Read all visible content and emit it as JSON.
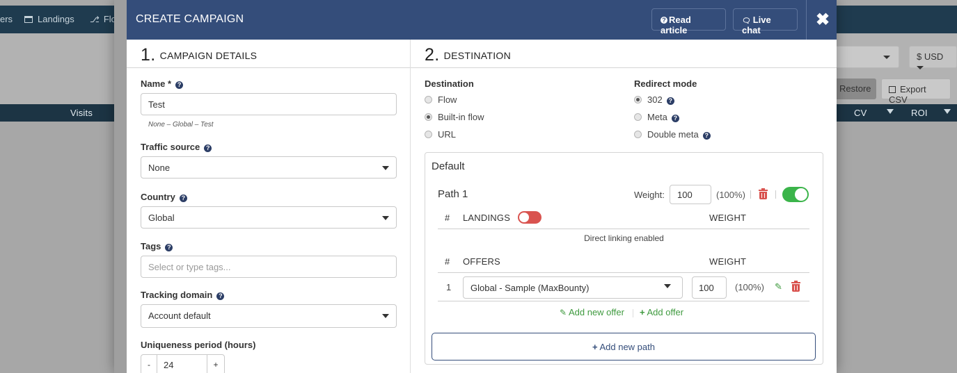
{
  "background": {
    "nav": [
      {
        "label": "ers"
      },
      {
        "label": "Landings"
      },
      {
        "label": "Flows"
      }
    ],
    "currency_select": "$ USD",
    "restore_label": "Restore",
    "export_label": "Export CSV",
    "columns": {
      "visits": "Visits",
      "cv": "CV",
      "roi": "ROI"
    }
  },
  "modal": {
    "title": "CREATE CAMPAIGN",
    "read_article": "Read article",
    "live_chat": "Live chat"
  },
  "details": {
    "step_num": "1.",
    "step_title": "CAMPAIGN DETAILS",
    "name_label": "Name *",
    "name_value": "Test",
    "name_hint": "None – Global – Test",
    "traffic_label": "Traffic source",
    "traffic_value": "None",
    "country_label": "Country",
    "country_value": "Global",
    "tags_label": "Tags",
    "tags_placeholder": "Select or type tags...",
    "domain_label": "Tracking domain",
    "domain_value": "Account default",
    "uniqueness_label": "Uniqueness period (hours)",
    "uniqueness_minus": "-",
    "uniqueness_value": "24",
    "uniqueness_plus": "+"
  },
  "destination": {
    "step_num": "2.",
    "step_title": "DESTINATION",
    "dest_label": "Destination",
    "dest_options": [
      "Flow",
      "Built-in flow",
      "URL"
    ],
    "dest_selected": "Built-in flow",
    "redirect_label": "Redirect mode",
    "redirect_options": [
      "302",
      "Meta",
      "Double meta"
    ],
    "redirect_selected": "302",
    "panel_title": "Default",
    "path_name": "Path 1",
    "weight_label": "Weight:",
    "weight_value": "100",
    "weight_pct": "(100%)",
    "path_enabled": true,
    "landings": {
      "hash": "#",
      "header": "LANDINGS",
      "weight_header": "WEIGHT",
      "enabled": false,
      "empty_text": "Direct linking enabled"
    },
    "offers": {
      "hash": "#",
      "header": "OFFERS",
      "weight_header": "WEIGHT",
      "rows": [
        {
          "index": "1",
          "offer": "Global - Sample (MaxBounty)",
          "weight": "100",
          "pct": "(100%)"
        }
      ]
    },
    "add_new_offer": "Add new offer",
    "add_offer": "Add offer",
    "add_new_path": "Add new path"
  }
}
